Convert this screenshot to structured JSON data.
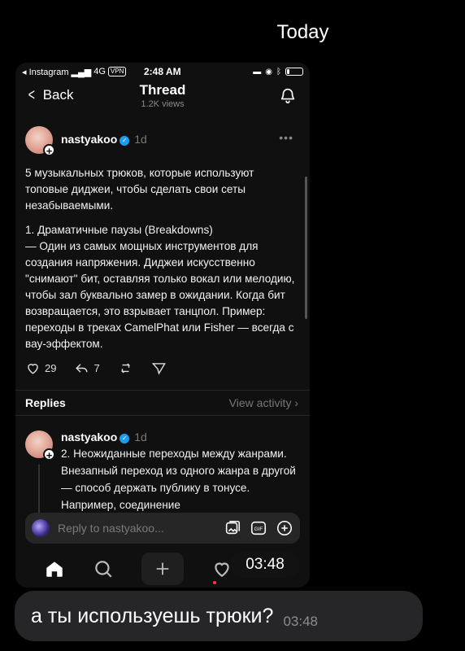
{
  "chat": {
    "day_label": "Today",
    "overlay_time": "03:48",
    "message": {
      "text": "а ты используешь трюки?",
      "time": "03:48"
    }
  },
  "screenshot": {
    "statusbar": {
      "carrier": "◂ Instagram",
      "network": "4G",
      "vpn": "VPN",
      "time": "2:48 AM"
    },
    "header": {
      "back_label": "Back",
      "title": "Thread",
      "views": "1.2K views"
    },
    "post": {
      "username": "nastyakoo",
      "verified_icon": "✓",
      "age": "1d",
      "more": "•••",
      "paragraphs": [
        "5 музыкальных трюков, которые используют топовые диджеи, чтобы сделать свои сеты незабываемыми.",
        "1. Драматичные паузы (Breakdowns)\n — Один из самых мощных инструментов для создания напряжения. Диджеи искусственно \"снимают\" бит, оставляя только вокал или мелодию, чтобы зал буквально замер в ожидании. Когда бит возвращается, это взрывает танцпол.  Пример: переходы в треках CamelPhat или Fisher — всегда с вау-эффектом."
      ],
      "likes": "29",
      "reposts": "7"
    },
    "replies": {
      "title": "Replies",
      "view_activity": "View activity ›"
    },
    "reply": {
      "username": "nastyakoo",
      "age": "1d",
      "text": "2. Неожиданные переходы между жанрами. Внезапный переход из одного жанра в другой — способ держать публику в тонусе. Например, соединение"
    },
    "composer": {
      "placeholder": "Reply to nastyakoo..."
    },
    "colors": {
      "verified": "#1d9bf0",
      "notification_dot": "#ff3040",
      "bubble": "#262628"
    }
  }
}
